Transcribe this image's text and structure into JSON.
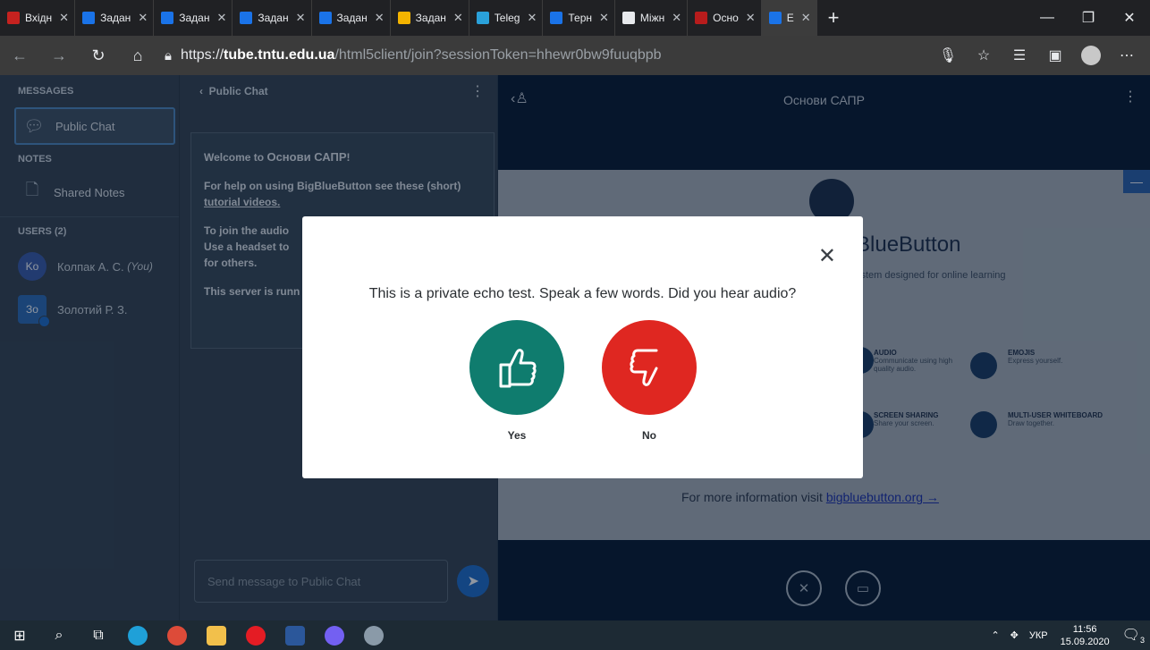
{
  "browser": {
    "tabs": [
      {
        "label": "Вхідн",
        "icon": "gmail-icon",
        "color": "#c5221f"
      },
      {
        "label": "Задан",
        "icon": "classroom-icon",
        "color": "#1a73e8"
      },
      {
        "label": "Задан",
        "icon": "classroom-icon",
        "color": "#1a73e8"
      },
      {
        "label": "Задан",
        "icon": "classroom-icon",
        "color": "#1a73e8"
      },
      {
        "label": "Задан",
        "icon": "classroom-icon",
        "color": "#1a73e8"
      },
      {
        "label": "Задан",
        "icon": "classroom-icon",
        "color": "#f4b400"
      },
      {
        "label": "Teleg",
        "icon": "telegram-icon",
        "color": "#2aa1da"
      },
      {
        "label": "Терн",
        "icon": "site-icon",
        "color": "#1a73e8"
      },
      {
        "label": "Міжн",
        "icon": "globe-icon",
        "color": "#e8eaed"
      },
      {
        "label": "Осно",
        "icon": "site-icon",
        "color": "#b71c1c"
      },
      {
        "label": "Е",
        "icon": "bbb-icon",
        "color": "#1a73e8"
      }
    ],
    "new_tab": "+",
    "url_scheme": "https://",
    "url_host": "tube.tntu.edu.ua",
    "url_path": "/html5client/join?sessionToken=hhewr0bw9fuuqbpb"
  },
  "sidebar": {
    "messages_title": "MESSAGES",
    "public_chat": "Public Chat",
    "notes_title": "NOTES",
    "shared_notes": "Shared Notes",
    "users_title": "USERS (2)",
    "users": [
      {
        "initials": "Ko",
        "name": "Колпак А. С.",
        "you": "(You)",
        "color": "#3a5aa8"
      },
      {
        "initials": "Зо",
        "name": "Золотий Р. З.",
        "you": "",
        "color": "#2d6bb5"
      }
    ]
  },
  "chat": {
    "header": "Public Chat",
    "welcome_prefix": "Welcome to ",
    "welcome_course": "Основи САПР",
    "welcome_suffix": "!",
    "help_text": "For help on using BigBlueButton see these (short) ",
    "help_link": "tutorial videos.",
    "audio_text": "To join the audio",
    "headset_text": "Use a headset to",
    "others_text": "for others.",
    "server_text": "This server is runn",
    "input_placeholder": "Send message to Public Chat"
  },
  "main": {
    "title": "Основи САПР",
    "slide_title": "BlueButton",
    "slide_sub": "ystem designed for online learning",
    "features": [
      {
        "title": "AUDIO",
        "desc": "Communicate using high quality audio."
      },
      {
        "title": "EMOJIS",
        "desc": "Express yourself."
      },
      {
        "title": "SCREEN SHARING",
        "desc": "Share your screen."
      },
      {
        "title": "MULTI-USER WHITEBOARD",
        "desc": "Draw together."
      }
    ],
    "more_text": "For more information visit ",
    "more_link": "bigbluebutton.org →"
  },
  "modal": {
    "question": "This is a private echo test. Speak a few words. Did you hear audio?",
    "yes_label": "Yes",
    "no_label": "No",
    "yes_color": "#0f7c6e",
    "no_color": "#df2721"
  },
  "taskbar": {
    "lang": "УКР",
    "time": "11:56",
    "date": "15.09.2020",
    "notif_count": "3"
  }
}
